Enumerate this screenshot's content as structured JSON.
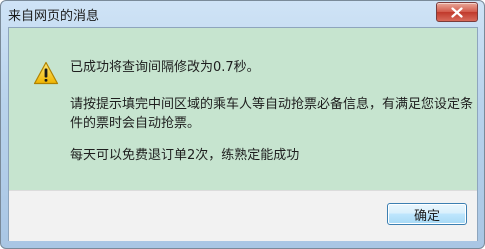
{
  "window": {
    "title": "来自网页的消息",
    "close_icon": "close-icon"
  },
  "dialog": {
    "icon": "warning-icon",
    "messages": [
      "已成功将查询间隔修改为0.7秒。",
      "请按提示填完中间区域的乘车人等自动抢票必备信息，有满足您设定条",
      "件的票时会自动抢票。",
      "每天可以免费退订单2次，练熟定能成功"
    ],
    "ok_label": "确定"
  },
  "colors": {
    "message_background": "#c6e4cf",
    "footer_background": "#f2f2f2",
    "title_bar": "#b9d3ec",
    "close_button": "#c0392b",
    "warning_yellow": "#f5c518"
  }
}
